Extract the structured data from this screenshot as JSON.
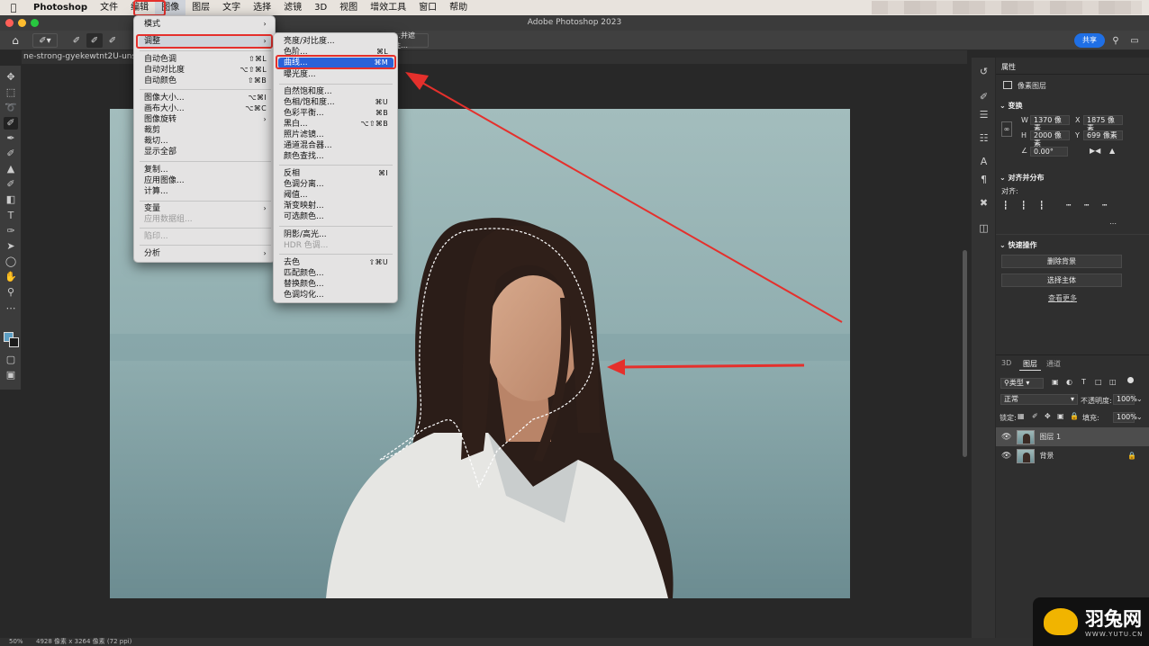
{
  "menubar": {
    "apple": "",
    "app": "Photoshop",
    "items": [
      "文件",
      "编辑",
      "图像",
      "图层",
      "文字",
      "选择",
      "滤镜",
      "3D",
      "视图",
      "增效工具",
      "窗口",
      "帮助"
    ]
  },
  "window_title": "Adobe Photoshop 2023",
  "options_bar": {
    "refine_edge": "…并遮住…",
    "share": "共享"
  },
  "doc_tab": "ne-strong-gyekewtnt2U-unspla",
  "image_menu": {
    "items": [
      {
        "label": "模式",
        "shortcut": "›"
      },
      {
        "label": "调整",
        "shortcut": "›"
      },
      {
        "label": "自动色调",
        "shortcut": "⇧⌘L"
      },
      {
        "label": "自动对比度",
        "shortcut": "⌥⇧⌘L"
      },
      {
        "label": "自动颜色",
        "shortcut": "⇧⌘B"
      },
      {
        "label": "图像大小...",
        "shortcut": "⌥⌘I"
      },
      {
        "label": "画布大小...",
        "shortcut": "⌥⌘C"
      },
      {
        "label": "图像旋转",
        "shortcut": "›"
      },
      {
        "label": "裁剪",
        "shortcut": ""
      },
      {
        "label": "裁切...",
        "shortcut": ""
      },
      {
        "label": "显示全部",
        "shortcut": ""
      },
      {
        "label": "复制...",
        "shortcut": ""
      },
      {
        "label": "应用图像...",
        "shortcut": ""
      },
      {
        "label": "计算...",
        "shortcut": ""
      },
      {
        "label": "变量",
        "shortcut": "›"
      },
      {
        "label": "应用数据组...",
        "shortcut": ""
      },
      {
        "label": "陷印...",
        "shortcut": ""
      },
      {
        "label": "分析",
        "shortcut": "›"
      }
    ]
  },
  "adjust_menu": {
    "items": [
      {
        "label": "亮度/对比度...",
        "shortcut": ""
      },
      {
        "label": "色阶...",
        "shortcut": "⌘L"
      },
      {
        "label": "曲线...",
        "shortcut": "⌘M"
      },
      {
        "label": "曝光度...",
        "shortcut": ""
      },
      {
        "label": "自然饱和度...",
        "shortcut": ""
      },
      {
        "label": "色相/饱和度...",
        "shortcut": "⌘U"
      },
      {
        "label": "色彩平衡...",
        "shortcut": "⌘B"
      },
      {
        "label": "黑白...",
        "shortcut": "⌥⇧⌘B"
      },
      {
        "label": "照片滤镜...",
        "shortcut": ""
      },
      {
        "label": "通道混合器...",
        "shortcut": ""
      },
      {
        "label": "颜色查找...",
        "shortcut": ""
      },
      {
        "label": "反相",
        "shortcut": "⌘I"
      },
      {
        "label": "色调分离...",
        "shortcut": ""
      },
      {
        "label": "阈值...",
        "shortcut": ""
      },
      {
        "label": "渐变映射...",
        "shortcut": ""
      },
      {
        "label": "可选颜色...",
        "shortcut": ""
      },
      {
        "label": "阴影/高光...",
        "shortcut": ""
      },
      {
        "label": "HDR 色调...",
        "shortcut": ""
      },
      {
        "label": "去色",
        "shortcut": "⇧⌘U"
      },
      {
        "label": "匹配颜色...",
        "shortcut": ""
      },
      {
        "label": "替换颜色...",
        "shortcut": ""
      },
      {
        "label": "色调均化...",
        "shortcut": ""
      }
    ]
  },
  "properties": {
    "tab": "属性",
    "kind": "像素图层",
    "transform_title": "变换",
    "w_label": "W",
    "w_value": "1370 像素",
    "x_label": "X",
    "x_value": "1875 像素",
    "h_label": "H",
    "h_value": "2000 像素",
    "y_label": "Y",
    "y_value": "699 像素",
    "angle": "0.00°",
    "align_title": "对齐并分布",
    "align_label": "对齐:",
    "quick_title": "快速操作",
    "remove_bg": "删除背景",
    "select_subject": "选择主体",
    "see_more": "查看更多"
  },
  "layers_panel": {
    "tabs": [
      "3D",
      "图层",
      "通道"
    ],
    "filter": "类型",
    "blend": "正常",
    "opacity_label": "不透明度:",
    "opacity": "100%",
    "lock_label": "锁定:",
    "fill_label": "填充:",
    "fill": "100%",
    "layers": [
      {
        "name": "图层 1"
      },
      {
        "name": "背景"
      }
    ]
  },
  "status": {
    "zoom": "50%",
    "doc_info": "4928 像素 x 3264 像素 (72 ppi)"
  },
  "watermark": {
    "text": "羽兔网",
    "url": "WWW.YUTU.CN"
  },
  "colors": {
    "annotation_red": "#e5302c",
    "selection_blue": "#2a62d9",
    "share_blue": "#1f6fe5"
  }
}
